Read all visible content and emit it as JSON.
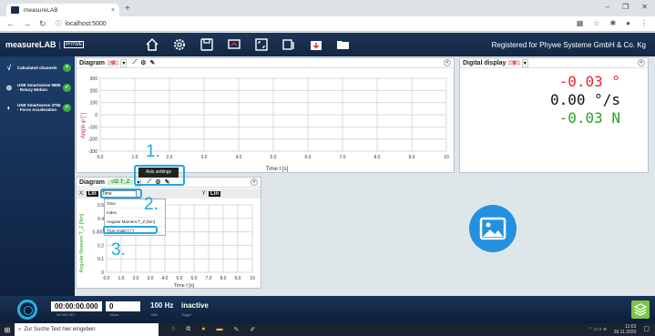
{
  "browser": {
    "tab_title": "measureLAB",
    "tab_close": "×",
    "new_tab": "+",
    "url": "localhost:5000",
    "win_min": "–",
    "win_max": "❐",
    "win_close": "✕"
  },
  "header": {
    "logo": "measureLAB",
    "logo_sub": "PHYWE",
    "registered": "Registered for Phywe Systeme GmbH & Co. Kg"
  },
  "sidebar": {
    "items": [
      {
        "label": "Calculated channels",
        "icon": "√"
      },
      {
        "label": "USB Smartsense 0805 · Rotary Motion",
        "icon": "⊜"
      },
      {
        "label": "USB Smartsense 3755 · Force Acceleration",
        "icon": "◐"
      }
    ]
  },
  "diagram1": {
    "title": "Diagram",
    "selector": "φ",
    "ylabel": "Angle φ [°]",
    "xlabel": "Time t [s]",
    "yticks": [
      "300",
      "200",
      "100",
      "0",
      "-100",
      "-200",
      "-300"
    ],
    "xticks": [
      "0.0",
      "1.0",
      "2.0",
      "3.0",
      "4.0",
      "5.0",
      "6.0",
      "7.0",
      "8.0",
      "9.0",
      "10"
    ]
  },
  "digital": {
    "title": "Digital display",
    "selector": "φ",
    "values": [
      {
        "text": "-0.03 °",
        "color": "#e8262c"
      },
      {
        "text": "0.00 °/s",
        "color": "#111111"
      },
      {
        "text": "-0.03 N",
        "color": "#27a327"
      }
    ]
  },
  "diagram2": {
    "title": "Diagram",
    "selector": "√Ω T_Z",
    "x_label": "X:",
    "y_label": "Y:",
    "lin_x": "Lin",
    "lin_y": "Lin",
    "x_select": "Time",
    "ylabel": "Angular Moment T_Z [Nm]",
    "xlabel": "Time t [s]",
    "yticks": [
      "0.5",
      "0.4",
      "0.300",
      "0.2",
      "0.1",
      "0"
    ],
    "xticks": [
      "0.0",
      "1.0",
      "2.0",
      "3.0",
      "4.0",
      "5.0",
      "6.0",
      "7.0",
      "8.0",
      "9.0",
      "10"
    ],
    "dropdown": [
      "Time",
      "Index",
      "Angular Moment T_Z [Nm]",
      "True Angle f (°)"
    ]
  },
  "tooltip": "Axis settings",
  "annotations": {
    "a1": "1.",
    "a2": "2.",
    "a3": "3."
  },
  "bottom": {
    "time": "00:00:00.000",
    "time_sub": "HR MIN SEC",
    "values_box": "0",
    "values_sub": "Values",
    "rate": "100 Hz",
    "rate_sub": "Rate",
    "status": "inactive",
    "trigger_sub": "Trigger"
  },
  "taskbar": {
    "search": "Zur Suche Text hier eingeben",
    "time": "11:03",
    "date": "26.11.2020"
  },
  "colors": {
    "accent": "#20a7de",
    "header": "#1d3557",
    "ok": "#3cb043"
  }
}
